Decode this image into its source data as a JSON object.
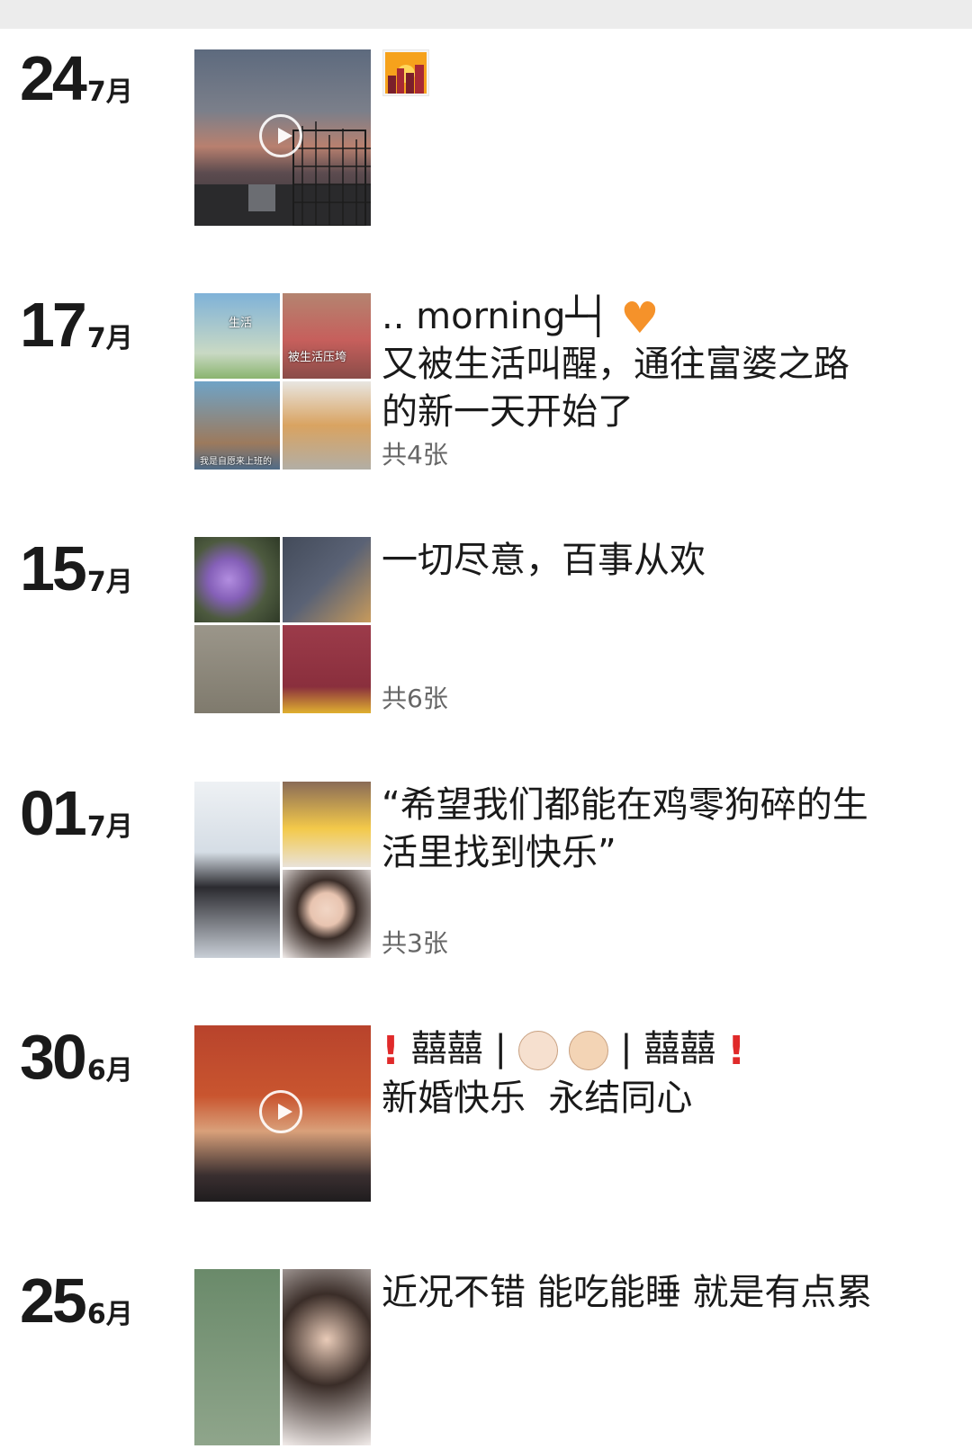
{
  "posts": [
    {
      "day": "24",
      "month": "7月",
      "media_type": "video",
      "text_lines": [],
      "count": ""
    },
    {
      "day": "17",
      "month": "7月",
      "media_type": "grid4",
      "tile_labels": [
        "生活",
        "被生活压垮",
        "我是自愿来上班的"
      ],
      "text_first": ".. morning┴┤",
      "heart_icon": "orange-heart",
      "text_lines": [
        "又被生活叫醒，通往富婆之路",
        "的新一天开始了"
      ],
      "count": "共4张"
    },
    {
      "day": "15",
      "month": "7月",
      "media_type": "grid4",
      "text_lines": [
        "一切尽意，百事从欢"
      ],
      "count": "共6张"
    },
    {
      "day": "01",
      "month": "7月",
      "media_type": "grid3",
      "text_lines": [
        "“希望我们都能在鸡零狗碎的生",
        "活里找到快乐”"
      ],
      "count": "共3张"
    },
    {
      "day": "30",
      "month": "6月",
      "media_type": "video",
      "line1_word": "囍囍",
      "divider": "|",
      "text_lines": [
        "新婚快乐  永结同心"
      ],
      "count": ""
    },
    {
      "day": "25",
      "month": "6月",
      "media_type": "grid2",
      "text_lines": [
        "近况不错 能吃能睡 就是有点累"
      ],
      "count": ""
    }
  ],
  "colors": {
    "background": "#ffffff",
    "text": "#1a1a1a",
    "count_text": "#666666",
    "heart": "#f5922a",
    "red_mark": "#e02a2a"
  },
  "icons": [
    "play-icon",
    "orange-heart-icon",
    "red-exclamation-icon",
    "bride-icon",
    "groom-icon",
    "city-sunset-sticker-icon"
  ]
}
